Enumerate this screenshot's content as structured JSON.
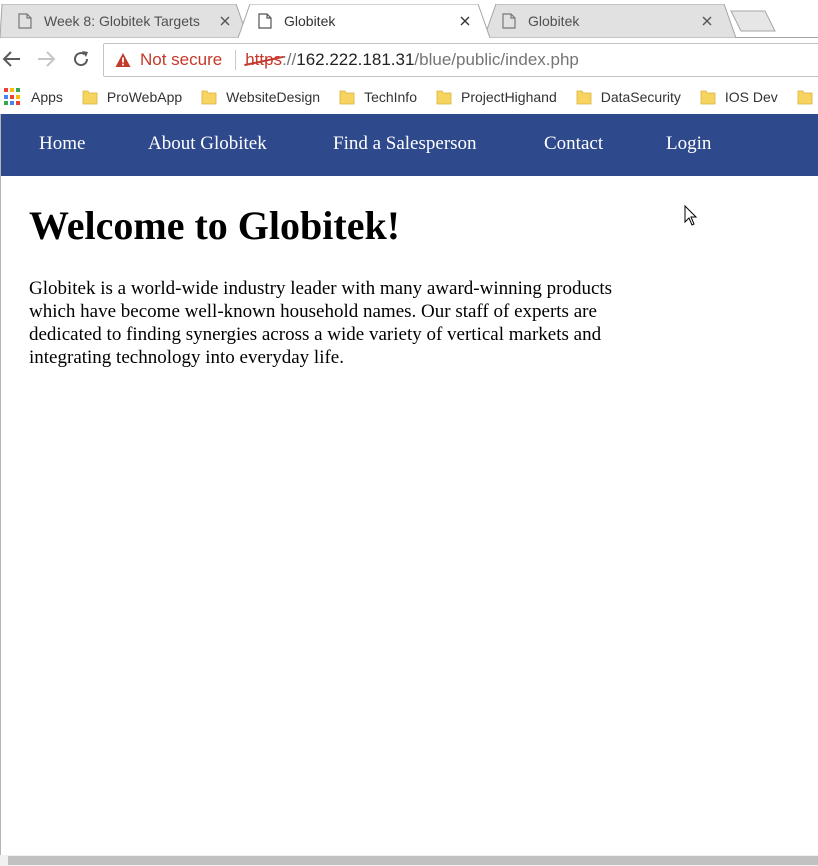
{
  "browser": {
    "tabs": [
      {
        "title": "Week 8: Globitek Targets",
        "active": false
      },
      {
        "title": "Globitek",
        "active": true
      },
      {
        "title": "Globitek",
        "active": false
      }
    ],
    "address_bar": {
      "security_label": "Not secure",
      "url_scheme": "https",
      "url_separator": "://",
      "url_host": "162.222.181.31",
      "url_path": "/blue/public/index.php"
    },
    "bookmarks": [
      {
        "label": "Apps",
        "icon": "apps-grid-icon"
      },
      {
        "label": "ProWebApp",
        "icon": "folder-icon"
      },
      {
        "label": "WebsiteDesign",
        "icon": "folder-icon"
      },
      {
        "label": "TechInfo",
        "icon": "folder-icon"
      },
      {
        "label": "ProjectHighand",
        "icon": "folder-icon"
      },
      {
        "label": "DataSecurity",
        "icon": "folder-icon"
      },
      {
        "label": "IOS Dev",
        "icon": "folder-icon"
      }
    ],
    "colors": {
      "warning": "#c5392b",
      "folder": "#f7d35f"
    }
  },
  "site": {
    "nav": [
      "Home",
      "About Globitek",
      "Find a Salesperson",
      "Contact",
      "Login"
    ],
    "title": "Welcome to Globitek!",
    "intro": "Globitek is a world-wide industry leader with many award-winning products which have become well-known household names. Our staff of experts are dedicated to finding synergies across a wide variety of vertical markets and integrating technology into everyday life.",
    "colors": {
      "nav_background": "#2e4a8c",
      "nav_text": "#ffffff"
    }
  }
}
